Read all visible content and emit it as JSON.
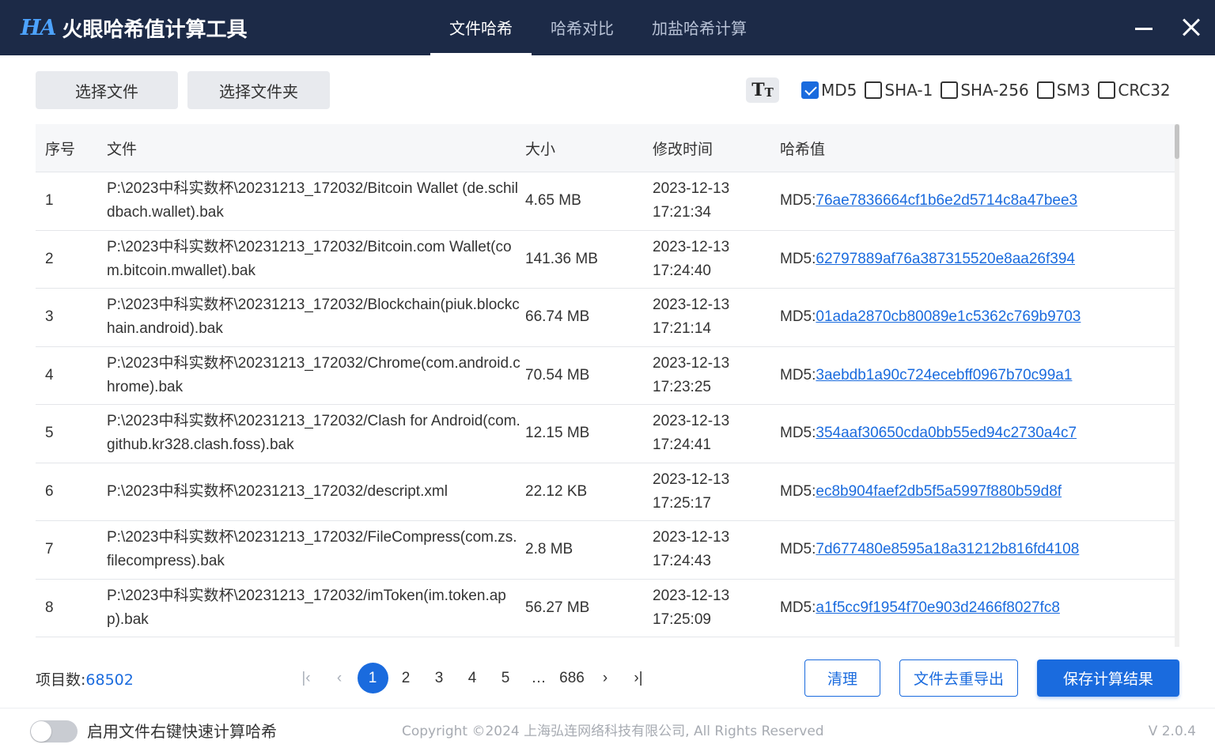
{
  "app": {
    "logo_mark": "HA",
    "title": "火眼哈希值计算工具",
    "accent_color": "#1a6bde",
    "titlebar_color": "#1c2a47"
  },
  "nav": {
    "tabs": [
      {
        "label": "文件哈希",
        "active": true
      },
      {
        "label": "哈希对比",
        "active": false
      },
      {
        "label": "加盐哈希计算",
        "active": false
      }
    ]
  },
  "window_controls": {
    "minimize_icon": "minimize-icon",
    "close_icon": "close-icon"
  },
  "toolbar": {
    "select_file": "选择文件",
    "select_folder": "选择文件夹",
    "font_icon": "font-size-icon",
    "font_glyph_big": "T",
    "font_glyph_small": "T",
    "algorithms": [
      {
        "label": "MD5",
        "checked": true
      },
      {
        "label": "SHA-1",
        "checked": false
      },
      {
        "label": "SHA-256",
        "checked": false
      },
      {
        "label": "SM3",
        "checked": false
      },
      {
        "label": "CRC32",
        "checked": false
      }
    ]
  },
  "table": {
    "headers": {
      "index": "序号",
      "file": "文件",
      "size": "大小",
      "mtime": "修改时间",
      "hash": "哈希值"
    },
    "rows": [
      {
        "index": "1",
        "file": "P:\\2023中科实数杯\\20231213_172032/Bitcoin Wallet (de.schildbach.wallet).bak",
        "size": "4.65 MB",
        "date": "2023-12-13",
        "time": "17:21:34",
        "hash_prefix": "MD5:",
        "hash": "76ae7836664cf1b6e2d5714c8a47bee3"
      },
      {
        "index": "2",
        "file": "P:\\2023中科实数杯\\20231213_172032/Bitcoin.com Wallet(com.bitcoin.mwallet).bak",
        "size": "141.36 MB",
        "date": "2023-12-13",
        "time": "17:24:40",
        "hash_prefix": "MD5:",
        "hash": "62797889af76a387315520e8aa26f394"
      },
      {
        "index": "3",
        "file": "P:\\2023中科实数杯\\20231213_172032/Blockchain(piuk.blockchain.android).bak",
        "size": "66.74 MB",
        "date": "2023-12-13",
        "time": "17:21:14",
        "hash_prefix": "MD5:",
        "hash": "01ada2870cb80089e1c5362c769b9703"
      },
      {
        "index": "4",
        "file": "P:\\2023中科实数杯\\20231213_172032/Chrome(com.android.chrome).bak",
        "size": "70.54 MB",
        "date": "2023-12-13",
        "time": "17:23:25",
        "hash_prefix": "MD5:",
        "hash": "3aebdb1a90c724ecebff0967b70c99a1"
      },
      {
        "index": "5",
        "file": "P:\\2023中科实数杯\\20231213_172032/Clash for Android(com.github.kr328.clash.foss).bak",
        "size": "12.15 MB",
        "date": "2023-12-13",
        "time": "17:24:41",
        "hash_prefix": "MD5:",
        "hash": "354aaf30650cda0bb55ed94c2730a4c7"
      },
      {
        "index": "6",
        "file": "P:\\2023中科实数杯\\20231213_172032/descript.xml",
        "size": "22.12 KB",
        "date": "2023-12-13",
        "time": "17:25:17",
        "hash_prefix": "MD5:",
        "hash": "ec8b904faef2db5f5a5997f880b59d8f"
      },
      {
        "index": "7",
        "file": "P:\\2023中科实数杯\\20231213_172032/FileCompress(com.zs.filecompress).bak",
        "size": "2.8 MB",
        "date": "2023-12-13",
        "time": "17:24:43",
        "hash_prefix": "MD5:",
        "hash": "7d677480e8595a18a31212b816fd4108"
      },
      {
        "index": "8",
        "file": "P:\\2023中科实数杯\\20231213_172032/imToken(im.token.app).bak",
        "size": "56.27 MB",
        "date": "2023-12-13",
        "time": "17:25:09",
        "hash_prefix": "MD5:",
        "hash": "a1f5cc9f1954f70e903d2466f8027fc8"
      }
    ]
  },
  "footer_bar": {
    "count_label": "项目数:",
    "count_value": "68502",
    "pages": [
      "1",
      "2",
      "3",
      "4",
      "5",
      "…",
      "686"
    ],
    "current_page": "1",
    "first_icon": "first-page-icon",
    "first_glyph": "|‹",
    "prev_icon": "prev-page-icon",
    "prev_glyph": "‹",
    "next_icon": "next-page-icon",
    "next_glyph": "›",
    "last_icon": "last-page-icon",
    "last_glyph": "›|",
    "clear_label": "清理",
    "dedup_export_label": "文件去重导出",
    "save_label": "保存计算结果"
  },
  "status": {
    "toggle_label": "启用文件右键快速计算哈希",
    "toggle_on": false,
    "copyright": "Copyright ©2024 上海弘连网络科技有限公司, All Rights Reserved",
    "version": "V 2.0.4"
  }
}
